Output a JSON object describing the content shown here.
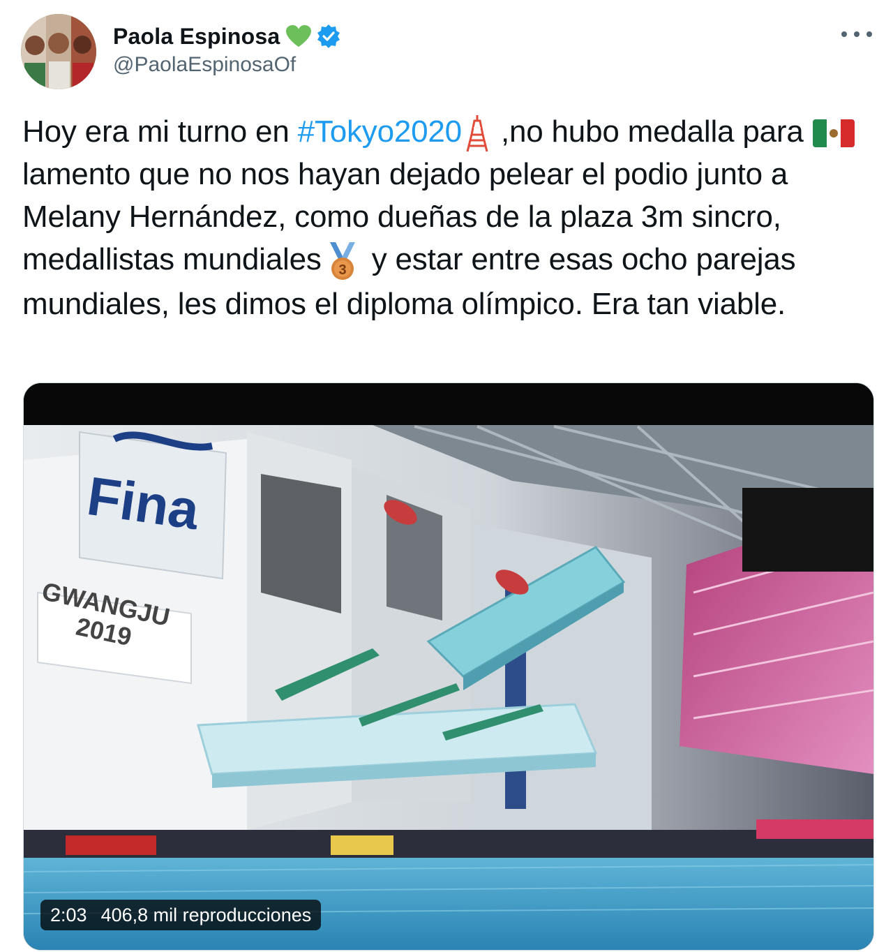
{
  "author": {
    "display_name": "Paola Espinosa",
    "handle": "@PaolaEspinosaOf",
    "avatar_icon": "profile-photo",
    "heart_icon": "green-heart-icon",
    "verified_icon": "verified-badge-icon"
  },
  "menu": {
    "more_icon": "more-options-icon"
  },
  "tweet": {
    "part1": "Hoy era mi turno en ",
    "hashtag": "#Tokyo2020",
    "part2": " ,no hubo medalla para ",
    "part3": " lamento que no nos hayan dejado pelear el podio junto a Melany Hernández, como dueñas de la plaza 3m sincro, medallistas mundiales",
    "part4": " y estar entre esas ocho parejas mundiales, les dimos el diploma olímpico. Era tan viable.",
    "emoji_tower": "tokyo-tower-icon",
    "emoji_flag": "mexico-flag-icon",
    "emoji_medal": "bronze-medal-icon",
    "medal_number": "3"
  },
  "media": {
    "duration": "2:03",
    "views": "406,8 mil reproducciones",
    "banner_line1": "GWANGJU",
    "banner_line2": "2019",
    "brand_logo": "Fina"
  },
  "colors": {
    "link": "#1d9bf0",
    "secondary": "#536471",
    "verified": "#1d9bf0",
    "heart": "#6dbf5b"
  }
}
